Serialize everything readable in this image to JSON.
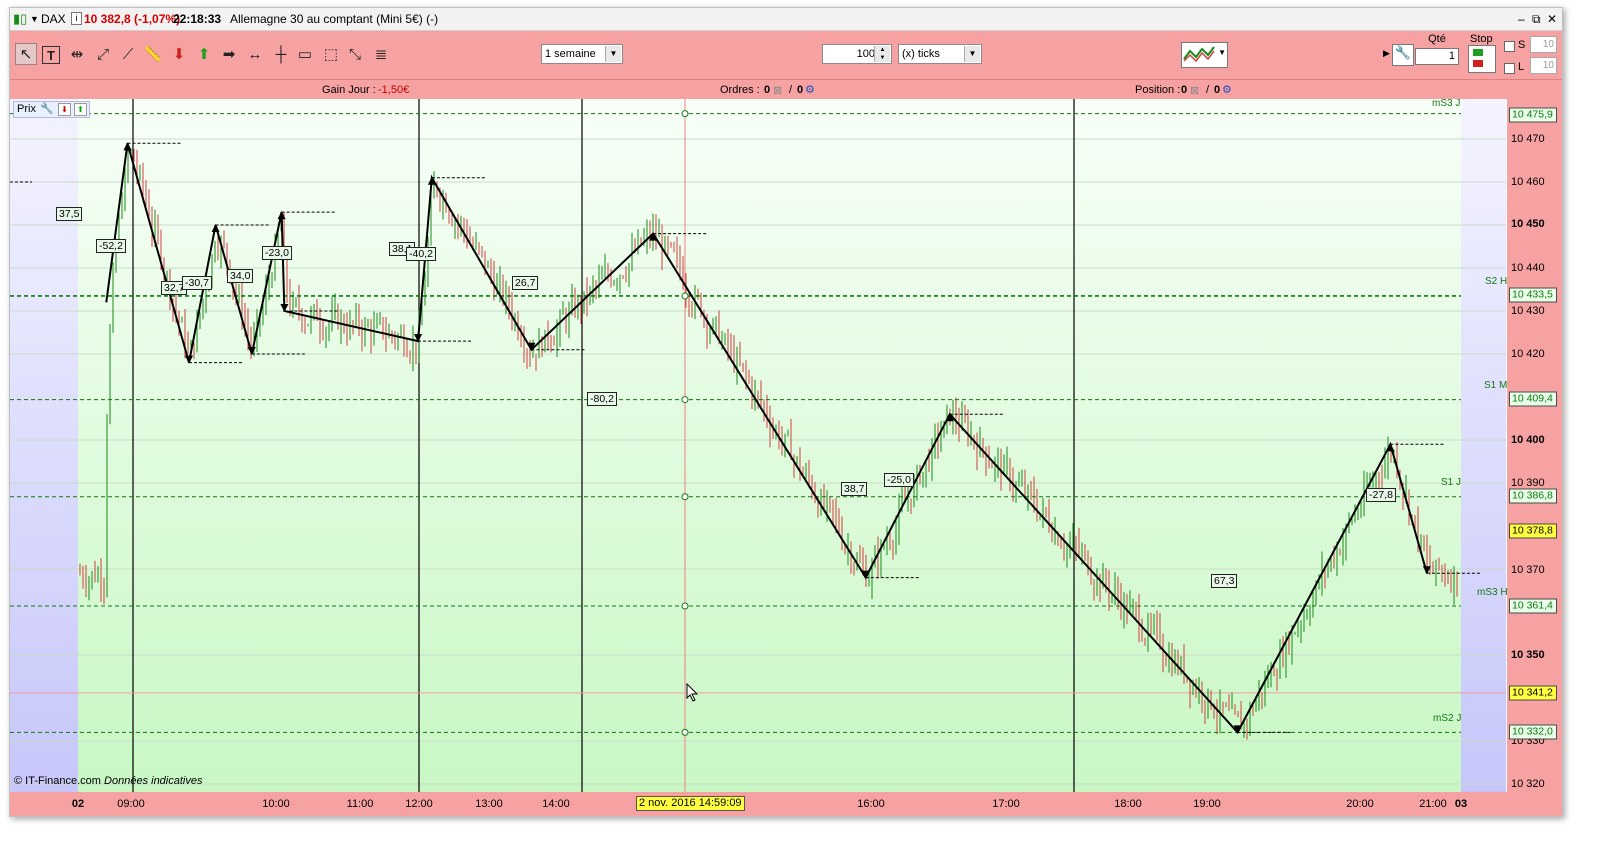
{
  "window": {
    "symbol": "DAX",
    "price_change": "10 382,8 (-1,07%)",
    "time": "22:18:33",
    "instrument": "Allemagne 30 au comptant (Mini 5€) (-)",
    "controls": [
      "–",
      "⧉",
      "✕"
    ]
  },
  "toolbar": {
    "period_select": "1 semaine",
    "quantity_value": "100",
    "units_select": "(x) ticks",
    "qte_label": "Qté",
    "qte_value": "1",
    "stop_label": "Stop",
    "s_label": "S",
    "l_label": "L",
    "s_value": "10",
    "l_value": "10"
  },
  "infobar": {
    "gain_label": "Gain Jour :",
    "gain_value": "-1,50€",
    "orders_label": "Ordres :",
    "orders_a": "0",
    "orders_sep": "/",
    "orders_b": "0",
    "position_label": "Position :",
    "position_a": "0",
    "position_sep": "/",
    "position_b": "0"
  },
  "panel": {
    "label": "Prix"
  },
  "footer": {
    "source": "© IT-Finance.com",
    "note": "Données indicatives"
  },
  "colors": {
    "bar_bg": "#f6a2a2",
    "level_green": "#117711",
    "zigzag": "#000000",
    "up_bar": "#1a8a1a",
    "down_bar": "#d04040"
  },
  "chart_data": {
    "type": "ohlc",
    "y_axis": {
      "ticks": [
        10470,
        10460,
        10450,
        10440,
        10430,
        10420,
        10400,
        10390,
        10370,
        10350,
        10330,
        10320
      ],
      "tick_labels": [
        "10 470",
        "10 460",
        "10 450",
        "10 440",
        "10 430",
        "10 420",
        "10 400",
        "10 390",
        "10 370",
        "10 350",
        "10 330",
        "10 320"
      ],
      "bold_ticks": [
        "10 450",
        "10 400",
        "10 350"
      ],
      "ylim": [
        10317,
        10479
      ]
    },
    "x_axis": {
      "labels": [
        "02",
        "09:00",
        "10:00",
        "11:00",
        "12:00",
        "13:00",
        "14:00",
        "16:00",
        "17:00",
        "18:00",
        "19:00",
        "20:00",
        "21:00",
        "03"
      ],
      "cursor_label": "2 nov. 2016 14:59:09"
    },
    "price_boxes": [
      {
        "label": "10 475,9",
        "value": 10475.9
      },
      {
        "label": "10 433,5",
        "value": 10433.5
      },
      {
        "label": "10 409,4",
        "value": 10409.4
      },
      {
        "label": "10 386,8",
        "value": 10386.8
      },
      {
        "label": "10 378,8",
        "value": 10378.8
      },
      {
        "label": "10 361,4",
        "value": 10361.4
      },
      {
        "label": "10 341,2",
        "value": 10341.2,
        "highlight": true
      },
      {
        "label": "10 332,0",
        "value": 10332.0
      }
    ],
    "levels": [
      {
        "name": "mS3 J",
        "value": 10475.9
      },
      {
        "name": "S2 H",
        "value": 10433.5
      },
      {
        "name": "S1 M",
        "value": 10409.4
      },
      {
        "name": "S1 J",
        "value": 10386.8
      },
      {
        "name": "mS3 H",
        "value": 10361.4
      },
      {
        "name": "mS2 J",
        "value": 10332.0
      }
    ],
    "zigzag_labels": [
      "37,5",
      "-52,2",
      "32,7",
      "-30,7",
      "34,0",
      "-23,0",
      "38,1",
      "-40,2",
      "26,7",
      "-80,2",
      "38,7",
      "-25,0",
      "67,3",
      "-27,8"
    ],
    "zigzag_points": [
      {
        "t": "08:32",
        "v": 10432
      },
      {
        "t": "08:56",
        "v": 10469
      },
      {
        "t": "09:24",
        "v": 10418
      },
      {
        "t": "09:35",
        "v": 10450
      },
      {
        "t": "09:50",
        "v": 10420
      },
      {
        "t": "10:04",
        "v": 10453
      },
      {
        "t": "10:06",
        "v": 10430
      },
      {
        "t": "11:59",
        "v": 10423
      },
      {
        "t": "12:11",
        "v": 10461
      },
      {
        "t": "13:38",
        "v": 10421
      },
      {
        "t": "14:37",
        "v": 10448
      },
      {
        "t": "15:58",
        "v": 10368
      },
      {
        "t": "16:35",
        "v": 10406
      },
      {
        "t": "19:12",
        "v": 10332
      },
      {
        "t": "20:25",
        "v": 10399
      },
      {
        "t": "20:55",
        "v": 10369
      }
    ]
  }
}
